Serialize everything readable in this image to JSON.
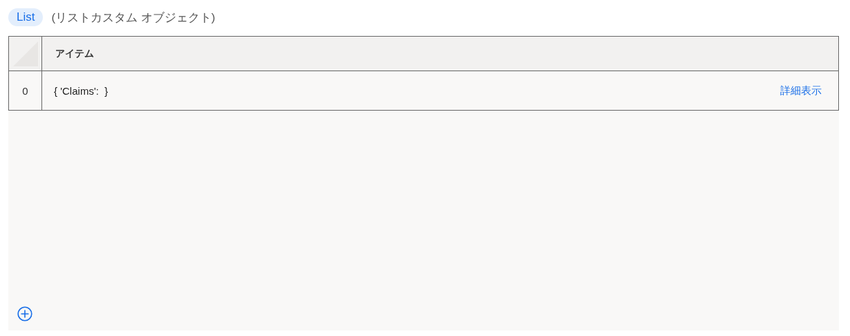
{
  "type_badge": "List",
  "type_description": "(リストカスタム オブジェクト)",
  "table": {
    "columns": [
      "アイテム"
    ],
    "rows": [
      {
        "index": "0",
        "value": "{ 'Claims':  }",
        "link": "詳細表示"
      }
    ]
  }
}
